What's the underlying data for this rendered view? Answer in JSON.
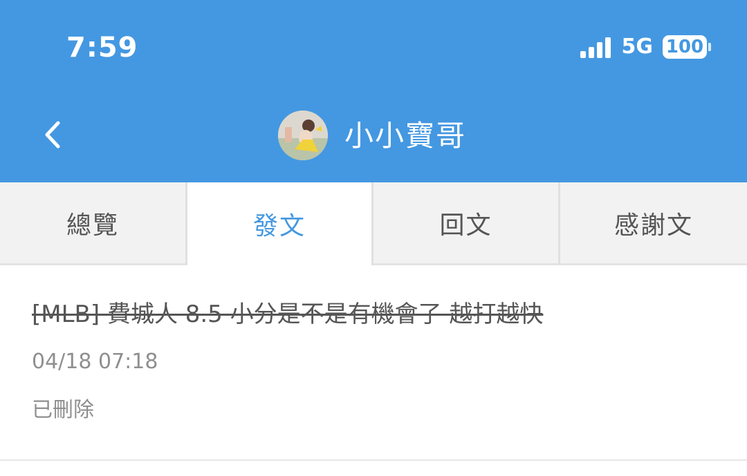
{
  "status_bar": {
    "time": "7:59",
    "network": "5G",
    "battery": "100",
    "icons": [
      "signal-icon",
      "battery-icon"
    ]
  },
  "header": {
    "back_icon": "chevron-left-icon",
    "profile_name": "小小寶哥",
    "background_color": "#4498e1"
  },
  "tabs": [
    {
      "label": "總覽",
      "active": false
    },
    {
      "label": "發文",
      "active": true
    },
    {
      "label": "回文",
      "active": false
    },
    {
      "label": "感謝文",
      "active": false
    }
  ],
  "posts": [
    {
      "title": "[MLB] 費城人 8.5 小分是不是有機會了 越打越快",
      "date": "04/18 07:18",
      "status": "已刪除",
      "struck_through": true
    }
  ],
  "colors": {
    "accent": "#4498e1",
    "tab_inactive_bg": "#f2f2f2",
    "text_muted": "#8f8f8f"
  }
}
